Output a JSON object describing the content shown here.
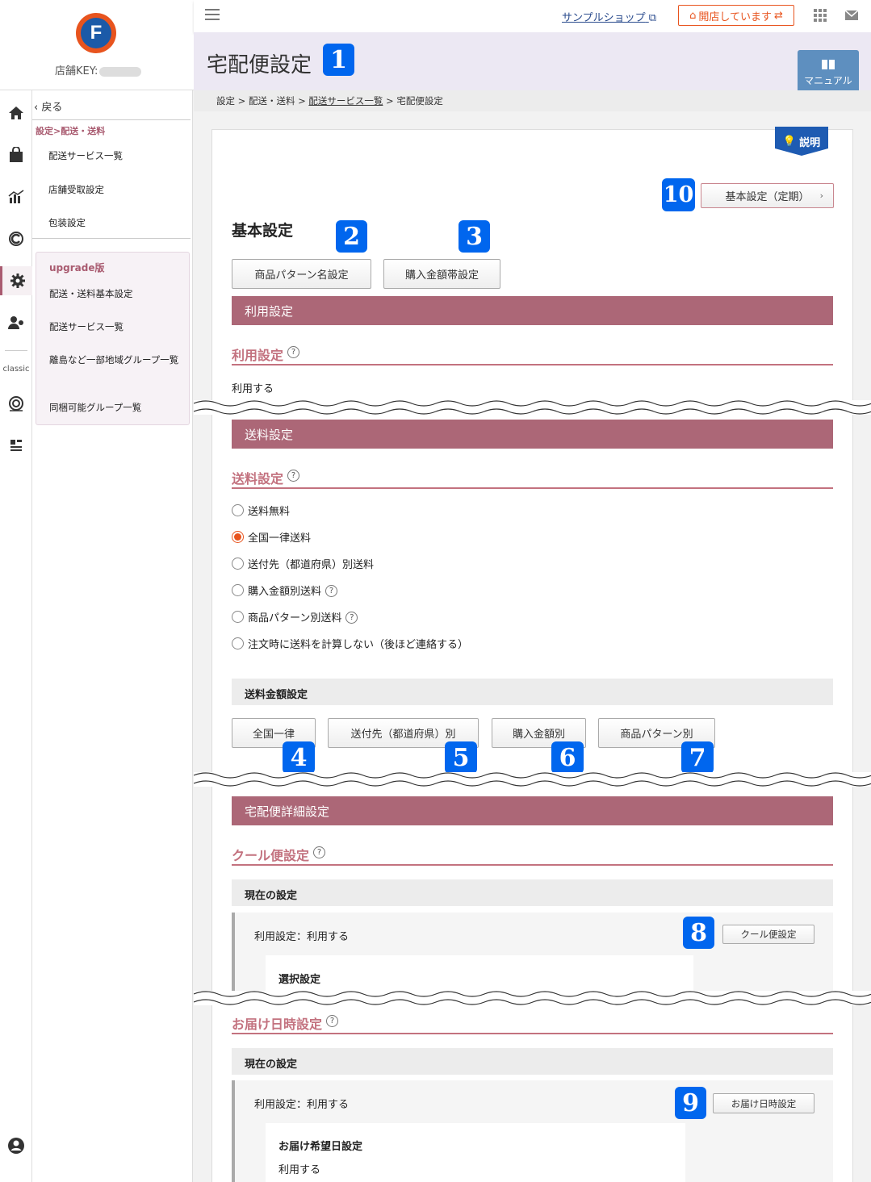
{
  "store": {
    "logo_letter": "F",
    "key_label": "店舗KEY:"
  },
  "topbar": {
    "shop_link": "サンプルショップ",
    "open_status": "開店しています"
  },
  "page": {
    "title": "宅配便設定",
    "manual_label": "マニュアル",
    "explain_label": "説明"
  },
  "breadcrumb": {
    "b1": "設定",
    "sep": " > ",
    "b2": "配送・送料",
    "b3": "配送サービス一覧",
    "b4": "宅配便設定"
  },
  "subnav": {
    "back": "戻る",
    "crumb": "設定>配送・送料",
    "items": [
      "配送サービス一覧",
      "店舗受取設定",
      "包装設定"
    ],
    "upgrade_title": "upgrade版",
    "upgrade_items": [
      "配送・送料基本設定",
      "配送サービス一覧",
      "離島など一部地域グループ一覧",
      "同梱可能グループ一覧"
    ]
  },
  "rail": {
    "classic_label": "classic"
  },
  "badges": [
    "1",
    "2",
    "3",
    "4",
    "5",
    "6",
    "7",
    "8",
    "9",
    "10"
  ],
  "basic": {
    "title": "基本設定",
    "pattern_btn": "商品パターン名設定",
    "amount_btn": "購入金額帯設定",
    "subscription_btn": "基本設定（定期）"
  },
  "usage": {
    "section": "利用設定",
    "subtitle": "利用設定",
    "value": "利用する"
  },
  "shipping": {
    "section": "送料設定",
    "subtitle": "送料設定",
    "options": [
      "送料無料",
      "全国一律送料",
      "送付先（都道府県）別送料",
      "購入金額別送料",
      "商品パターン別送料",
      "注文時に送料を計算しない（後ほど連絡する）"
    ],
    "selected_index": 1,
    "amount_title": "送料金額設定",
    "amount_buttons": [
      "全国一律",
      "送付先（都道府県）別",
      "購入金額別",
      "商品パターン別"
    ]
  },
  "detail": {
    "section": "宅配便詳細設定",
    "cool": {
      "subtitle": "クール便設定",
      "current": "現在の設定",
      "usage": "利用設定：利用する",
      "button": "クール便設定",
      "select_title": "選択設定"
    },
    "delivery": {
      "subtitle": "お届け日時設定",
      "current": "現在の設定",
      "usage": "利用設定：利用する",
      "button": "お届け日時設定",
      "date_title": "お届け希望日設定",
      "date_value": "利用する"
    }
  }
}
